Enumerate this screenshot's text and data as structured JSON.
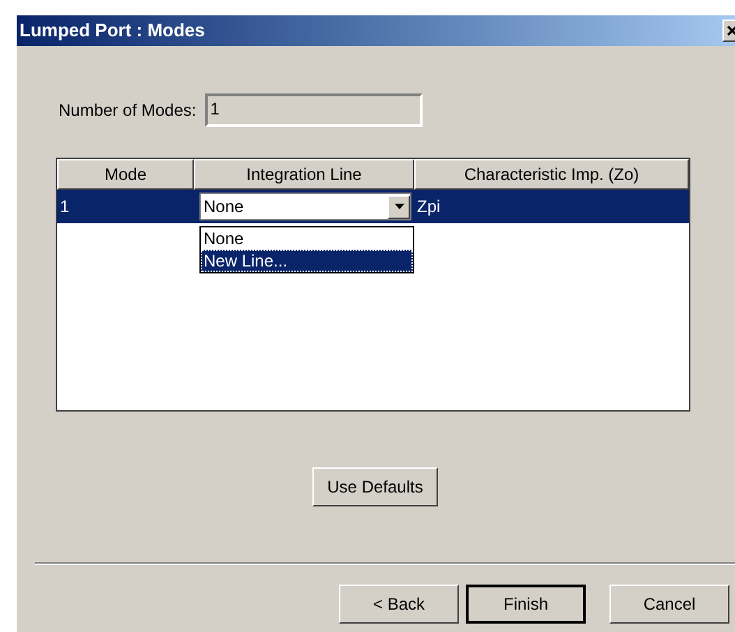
{
  "window": {
    "title": "Lumped Port : Modes"
  },
  "number_of_modes": {
    "label": "Number of Modes:",
    "value": "1",
    "disabled": true
  },
  "table": {
    "columns": [
      "Mode",
      "Integration Line",
      "Characteristic Imp. (Zo)"
    ],
    "rows": [
      {
        "mode": "1",
        "integration_line": "None",
        "impedance": "Zpi",
        "selected": true
      }
    ]
  },
  "dropdown": {
    "options": [
      {
        "label": "None",
        "selected": false
      },
      {
        "label": "New Line...",
        "selected": true
      }
    ]
  },
  "use_defaults_button": "Use Defaults",
  "buttons": [
    {
      "label": "< Back",
      "default": false
    },
    {
      "label": "Finish",
      "default": true
    },
    {
      "label": "Cancel",
      "default": false
    }
  ]
}
